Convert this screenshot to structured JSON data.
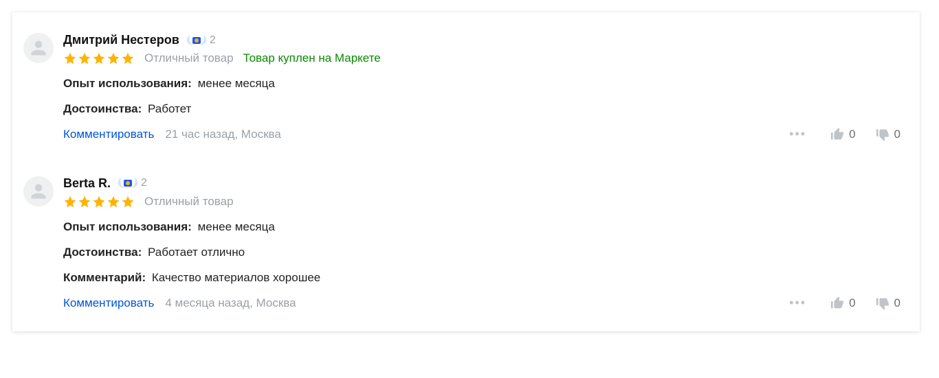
{
  "labels": {
    "experience": "Опыт использования:",
    "pros": "Достоинства:",
    "comment_field": "Комментарий:",
    "comment_action": "Комментировать"
  },
  "reviews": [
    {
      "author": "Дмитрий Нестеров",
      "level": "2",
      "stars": 5,
      "rating_text": "Отличный товар",
      "bought_text": "Товар куплен на Маркете",
      "experience": "менее месяца",
      "pros": "Работет",
      "comment": "",
      "timestamp": "21 час назад, Москва",
      "likes": "0",
      "dislikes": "0"
    },
    {
      "author": "Berta R.",
      "level": "2",
      "stars": 5,
      "rating_text": "Отличный товар",
      "bought_text": "",
      "experience": "менее месяца",
      "pros": "Работает отлично",
      "comment": "Качество материалов хорошее",
      "timestamp": "4 месяца назад, Москва",
      "likes": "0",
      "dislikes": "0"
    }
  ]
}
